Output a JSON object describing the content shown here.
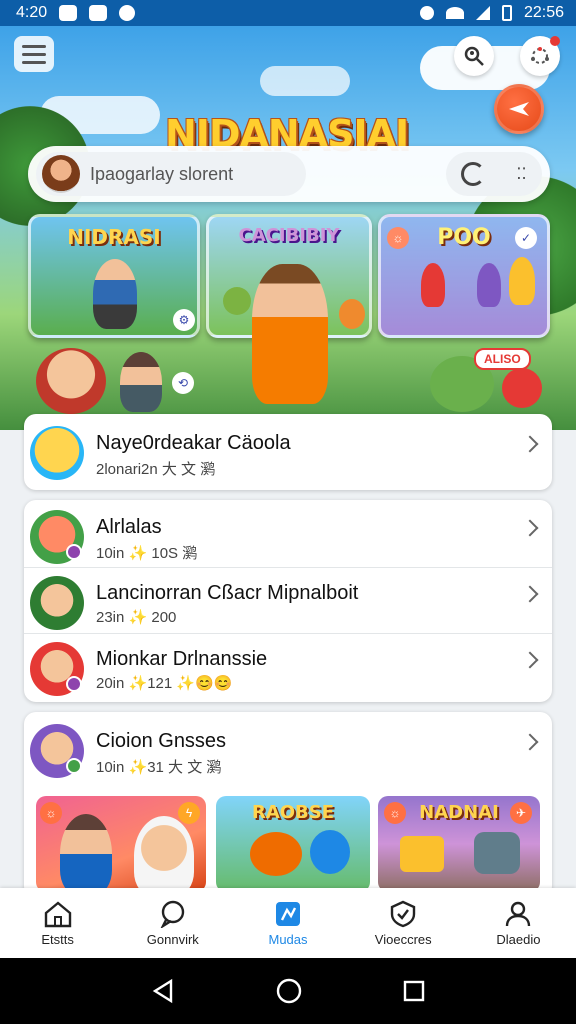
{
  "status_bar": {
    "time_left": "4:20",
    "time_right": "22:56"
  },
  "header": {
    "logo": "NIDANASIAI"
  },
  "search": {
    "placeholder": "Ipaogarlay slorent"
  },
  "featured": [
    {
      "title": "NIDRASI"
    },
    {
      "title": "CACIBIBIY"
    },
    {
      "title": "POO"
    }
  ],
  "featured_tag": "ALISO",
  "list_primary": {
    "name": "Nayе0rdeakar Cäoola",
    "sub": "2lonari2n 大 文 㶉"
  },
  "list_group": [
    {
      "name": "Alrlalas",
      "sub": "10in ✨ 10S 㶉"
    },
    {
      "name": "Lancinorran Cßacr Mipnalboit",
      "sub": "23in ✨ 200"
    },
    {
      "name": "Mionkar Drlnanssie",
      "sub": "20in ✨121 ✨😊😊"
    }
  ],
  "section": {
    "title": "Cioion Gnsses",
    "sub": "10in ✨31 大 文 㶉"
  },
  "thumbs": [
    {
      "title": ""
    },
    {
      "title": "RAOBSE"
    },
    {
      "title": "NADNAI"
    }
  ],
  "bottom_nav": [
    {
      "label": "Etstts",
      "icon": "home-icon"
    },
    {
      "label": "Gonnvirk",
      "icon": "chat-icon"
    },
    {
      "label": "Mudas",
      "icon": "media-icon",
      "active": true
    },
    {
      "label": "Vioeccres",
      "icon": "shield-icon"
    },
    {
      "label": "Dlaedio",
      "icon": "profile-icon"
    }
  ],
  "colors": {
    "accent": "#1e88e5",
    "brand": "#ffce2e",
    "fab": "#e64a19"
  }
}
